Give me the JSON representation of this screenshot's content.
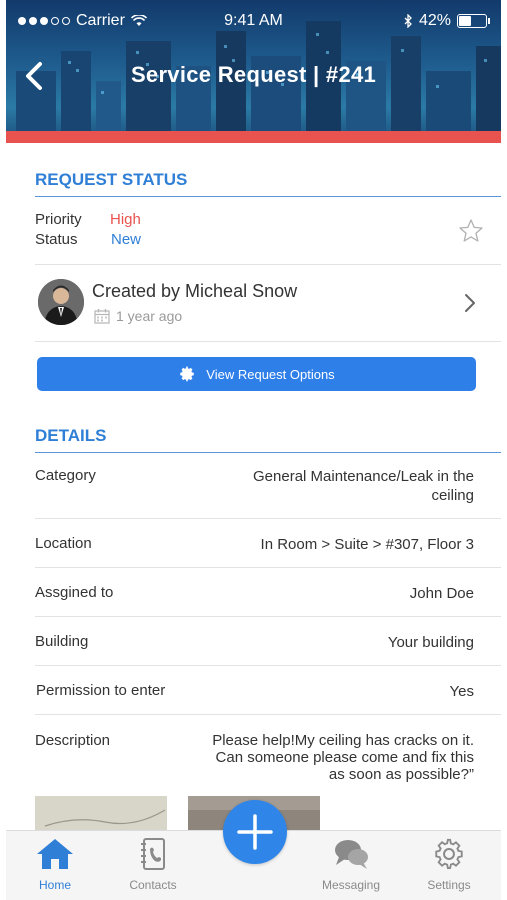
{
  "status_bar": {
    "carrier": "Carrier",
    "time": "9:41 AM",
    "battery": "42%",
    "battery_level": 0.42
  },
  "header": {
    "title": "Service Request | #241",
    "back_icon": "chevron-left-icon"
  },
  "request_status": {
    "heading": "REQUEST STATUS",
    "priority_label": "Priority",
    "priority_value": "High",
    "status_label": "Status",
    "status_value": "New",
    "star_icon": "star-outline-icon"
  },
  "creator": {
    "name": "Created by Micheal Snow",
    "time_ago": "1 year ago"
  },
  "options_button": {
    "label": "View Request Options",
    "icon": "gear-icon"
  },
  "details": {
    "heading": "DETAILS",
    "rows": [
      {
        "label": "Category",
        "value_line1": "General Maintenance/Leak in the",
        "value_line2": "ceiling"
      },
      {
        "label": "Location",
        "value": "In Room > Suite > #307,  Floor 3"
      },
      {
        "label": "Assgined to",
        "value": "John Doe"
      },
      {
        "label": "Building",
        "value": "Your building"
      },
      {
        "label": "Permission to enter",
        "value": "Yes"
      },
      {
        "label": "Description",
        "value_line1": "Please help!My ceiling has cracks on it.",
        "value_line2": "Can someone please come and fix this",
        "value_line3": "as soon as possible?”"
      }
    ]
  },
  "tabbar": {
    "tabs": [
      {
        "label": "Home",
        "icon": "home-icon"
      },
      {
        "label": "Contacts",
        "icon": "contacts-book-icon"
      },
      {
        "label": "Messaging",
        "icon": "chat-bubbles-icon"
      },
      {
        "label": "Settings",
        "icon": "gear-icon"
      }
    ],
    "fab_icon": "plus-icon"
  },
  "colors": {
    "accent": "#2f7fd6",
    "button": "#2f7fe8",
    "priority_high": "#e8534f",
    "status_new": "#2f7fd6",
    "header_stripe": "#e8534f"
  }
}
